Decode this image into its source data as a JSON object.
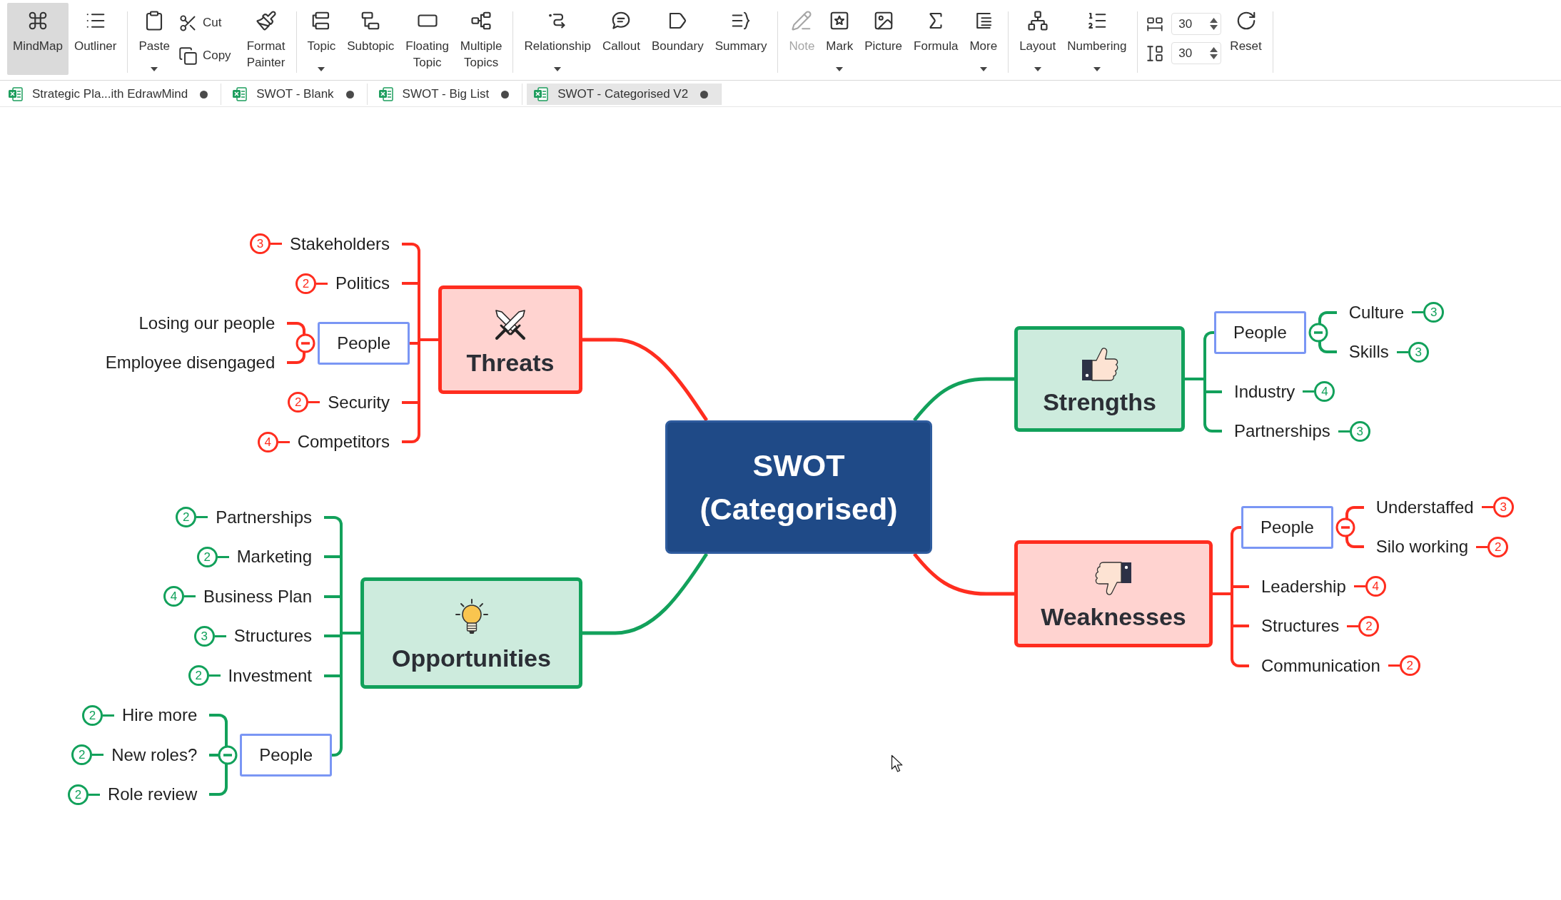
{
  "toolbar": {
    "groups": [
      {
        "items": [
          {
            "kind": "large",
            "label": "MindMap",
            "selected": true,
            "dropdown": false,
            "disabled": false
          },
          {
            "kind": "large",
            "label": "Outliner",
            "selected": false,
            "dropdown": false,
            "disabled": false
          }
        ]
      },
      {
        "items": [
          {
            "kind": "large",
            "label": "Paste",
            "dropdown": true,
            "disabled": false
          },
          {
            "kind": "stack",
            "buttons": [
              {
                "label": "Cut"
              },
              {
                "label": "Copy"
              }
            ]
          },
          {
            "kind": "large",
            "label": "Format Painter",
            "dropdown": false,
            "disabled": false
          }
        ]
      },
      {
        "items": [
          {
            "kind": "large",
            "label": "Topic",
            "dropdown": true,
            "disabled": false
          },
          {
            "kind": "large",
            "label": "Subtopic",
            "dropdown": false,
            "disabled": false
          },
          {
            "kind": "large",
            "label": "Floating Topic",
            "dropdown": false,
            "disabled": false
          },
          {
            "kind": "large",
            "label": "Multiple Topics",
            "dropdown": false,
            "disabled": false
          }
        ]
      },
      {
        "items": [
          {
            "kind": "large",
            "label": "Relationship",
            "dropdown": true,
            "disabled": false
          },
          {
            "kind": "large",
            "label": "Callout",
            "dropdown": false,
            "disabled": false
          },
          {
            "kind": "large",
            "label": "Boundary",
            "dropdown": false,
            "disabled": false
          },
          {
            "kind": "large",
            "label": "Summary",
            "dropdown": false,
            "disabled": false
          }
        ]
      },
      {
        "items": [
          {
            "kind": "large",
            "label": "Note",
            "dropdown": false,
            "disabled": true
          },
          {
            "kind": "large",
            "label": "Mark",
            "dropdown": true,
            "disabled": false
          },
          {
            "kind": "large",
            "label": "Picture",
            "dropdown": false,
            "disabled": false
          },
          {
            "kind": "large",
            "label": "Formula",
            "dropdown": false,
            "disabled": false
          },
          {
            "kind": "large",
            "label": "More",
            "dropdown": true,
            "disabled": false
          }
        ]
      },
      {
        "items": [
          {
            "kind": "large",
            "label": "Layout",
            "dropdown": true,
            "disabled": false
          },
          {
            "kind": "large",
            "label": "Numbering",
            "dropdown": true,
            "disabled": false
          }
        ]
      },
      {
        "items": [
          {
            "kind": "spacing",
            "fields": [
              {
                "value": "30"
              },
              {
                "value": "30"
              }
            ]
          },
          {
            "kind": "large",
            "label": "Reset",
            "dropdown": false,
            "disabled": false
          }
        ]
      }
    ]
  },
  "tabs": [
    {
      "label": "Strategic Pla...ith EdrawMind",
      "selected": false,
      "unsaved": true
    },
    {
      "label": "SWOT - Blank",
      "selected": false,
      "unsaved": true
    },
    {
      "label": "SWOT - Big List",
      "selected": false,
      "unsaved": true
    },
    {
      "label": "SWOT - Categorised V2",
      "selected": true,
      "unsaved": true
    }
  ],
  "mind_map": {
    "central_topic": {
      "label": "SWOT (Categorised)"
    },
    "main_topics": [
      {
        "label": "Threats",
        "color": "#ff2d1f",
        "children": [
          {
            "label": "Stakeholders",
            "marker": "3",
            "selected": false
          },
          {
            "label": "Politics",
            "marker": "2",
            "selected": false
          },
          {
            "label": "People",
            "selected": true,
            "expanded": true,
            "children": [
              {
                "label": "Losing our people",
                "selected": false
              },
              {
                "label": "Employee disengaged",
                "selected": false
              }
            ]
          },
          {
            "label": "Security",
            "marker": "2",
            "selected": false
          },
          {
            "label": "Competitors",
            "marker": "4",
            "selected": false
          }
        ]
      },
      {
        "label": "Strengths",
        "color": "#12a15b",
        "children": [
          {
            "label": "People",
            "selected": true,
            "expanded": true,
            "children": [
              {
                "label": "Culture",
                "marker": "3",
                "selected": false
              },
              {
                "label": "Skills",
                "marker": "3",
                "selected": false
              }
            ]
          },
          {
            "label": "Industry",
            "marker": "4",
            "selected": false
          },
          {
            "label": "Partnerships",
            "marker": "3",
            "selected": false
          }
        ]
      },
      {
        "label": "Weaknesses",
        "color": "#ff2d1f",
        "children": [
          {
            "label": "People",
            "selected": true,
            "expanded": true,
            "children": [
              {
                "label": "Understaffed",
                "marker": "3",
                "selected": false
              },
              {
                "label": "Silo working",
                "marker": "2",
                "selected": false
              }
            ]
          },
          {
            "label": "Leadership",
            "marker": "4",
            "selected": false
          },
          {
            "label": "Structures",
            "marker": "2",
            "selected": false
          },
          {
            "label": "Communication",
            "marker": "2",
            "selected": false
          }
        ]
      },
      {
        "label": "Opportunities",
        "color": "#12a15b",
        "children": [
          {
            "label": "Partnerships",
            "marker": "2",
            "selected": false
          },
          {
            "label": "Marketing",
            "marker": "2",
            "selected": false
          },
          {
            "label": "Business Plan",
            "marker": "4",
            "selected": false
          },
          {
            "label": "Structures",
            "marker": "3",
            "selected": false
          },
          {
            "label": "Investment",
            "marker": "2",
            "selected": false
          },
          {
            "label": "People",
            "selected": true,
            "expanded": true,
            "children": [
              {
                "label": "Hire more",
                "marker": "2",
                "selected": false
              },
              {
                "label": "New roles?",
                "marker": "2",
                "selected": false
              },
              {
                "label": "Role review",
                "marker": "2",
                "selected": false
              }
            ]
          }
        ]
      }
    ]
  }
}
